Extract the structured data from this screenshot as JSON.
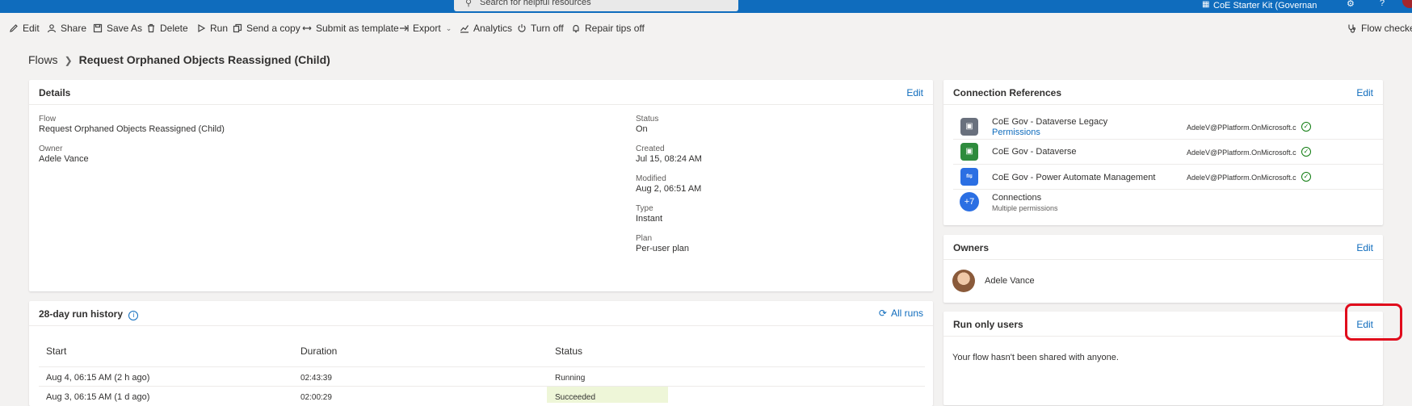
{
  "topbar": {
    "search_placeholder": "Search for helpful resources",
    "environment": "CoE Starter Kit (Governan"
  },
  "commands": {
    "edit": "Edit",
    "share": "Share",
    "save_as": "Save As",
    "delete": "Delete",
    "run": "Run",
    "send_copy": "Send a copy",
    "submit_template": "Submit as template",
    "export": "Export",
    "analytics": "Analytics",
    "turn_off": "Turn off",
    "repair_tips": "Repair tips off",
    "flow_checker": "Flow checker"
  },
  "breadcrumb": {
    "parent": "Flows",
    "current": "Request Orphaned Objects Reassigned (Child)"
  },
  "details": {
    "title": "Details",
    "edit": "Edit",
    "flow_label": "Flow",
    "flow_value": "Request Orphaned Objects Reassigned (Child)",
    "owner_label": "Owner",
    "owner_value": "Adele Vance",
    "status_label": "Status",
    "status_value": "On",
    "created_label": "Created",
    "created_value": "Jul 15, 08:24 AM",
    "modified_label": "Modified",
    "modified_value": "Aug 2, 06:51 AM",
    "type_label": "Type",
    "type_value": "Instant",
    "plan_label": "Plan",
    "plan_value": "Per-user plan"
  },
  "connections": {
    "title": "Connection References",
    "edit": "Edit",
    "items": [
      {
        "name": "CoE Gov - Dataverse Legacy",
        "link": "Permissions",
        "account": "AdeleV@PPlatform.OnMicrosoft.c",
        "icon": "dataverse-legacy-icon",
        "color": "#69707d"
      },
      {
        "name": "CoE Gov - Dataverse",
        "account": "AdeleV@PPlatform.OnMicrosoft.c",
        "icon": "dataverse-icon",
        "color": "#2e8b3d"
      },
      {
        "name": "CoE Gov - Power Automate Management",
        "account": "AdeleV@PPlatform.OnMicrosoft.c",
        "icon": "power-automate-icon",
        "color": "#2b6fe3"
      }
    ],
    "more_badge": "+7",
    "more_name": "Connections",
    "more_sub": "Multiple permissions"
  },
  "owners": {
    "title": "Owners",
    "edit": "Edit",
    "name": "Adele Vance"
  },
  "run_only": {
    "title": "Run only users",
    "edit": "Edit",
    "message": "Your flow hasn't been shared with anyone."
  },
  "history": {
    "title": "28-day run history",
    "all_runs": "All runs",
    "columns": [
      "Start",
      "Duration",
      "Status"
    ],
    "rows": [
      {
        "start": "Aug 4, 06:15 AM (2 h ago)",
        "duration": "02:43:39",
        "status": "Running"
      },
      {
        "start": "Aug 3, 06:15 AM (1 d ago)",
        "duration": "02:00:29",
        "status": "Succeeded"
      }
    ]
  }
}
